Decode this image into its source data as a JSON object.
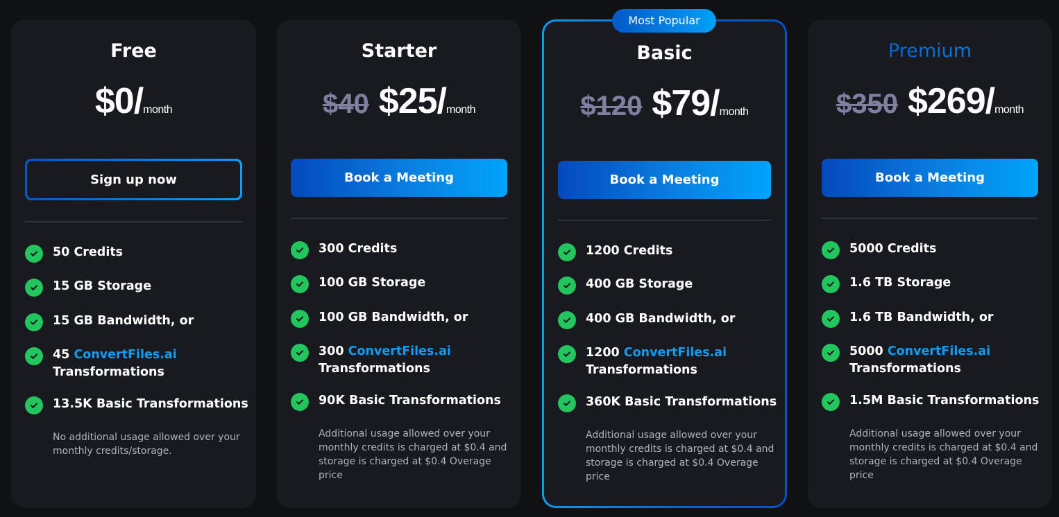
{
  "badge": "Most Popular",
  "colors": {
    "background": "#101113",
    "card": "#181a20",
    "accent_start": "#0449bd",
    "accent_end": "#00a4fb",
    "check": "#22c55e",
    "brand_link": "#129cf3",
    "old_price": "#7f80a0"
  },
  "plans": [
    {
      "name": "Free",
      "old_price": "",
      "price": "$0/",
      "period": "month",
      "button": "Sign up now",
      "features": {
        "credits": "50 Credits",
        "storage": "15 GB Storage",
        "bandwidth": "15 GB Bandwidth, or",
        "cf_count": "45",
        "cf_brand": "ConvertFiles.ai",
        "cf_suffix": "Transformations",
        "basic": "13.5K Basic Transformations"
      },
      "note": "No additional usage allowed over your monthly credits/storage."
    },
    {
      "name": "Starter",
      "old_price": "$40",
      "price": "$25/",
      "period": "month",
      "button": "Book a Meeting",
      "features": {
        "credits": "300 Credits",
        "storage": "100 GB Storage",
        "bandwidth": "100 GB Bandwidth, or",
        "cf_count": "300",
        "cf_brand": "ConvertFiles.ai",
        "cf_suffix": "Transformations",
        "basic": "90K Basic Transformations"
      },
      "note": "Additional usage allowed over your monthly credits is charged at $0.4 and storage is charged at $0.4 Overage price"
    },
    {
      "name": "Basic",
      "old_price": "$120",
      "price": "$79/",
      "period": "month",
      "button": "Book a Meeting",
      "features": {
        "credits": "1200 Credits",
        "storage": "400 GB Storage",
        "bandwidth": "400 GB Bandwidth, or",
        "cf_count": "1200",
        "cf_brand": "ConvertFiles.ai",
        "cf_suffix": "Transformations",
        "basic": "360K Basic Transformations"
      },
      "note": "Additional usage allowed over your monthly credits is charged at $0.4 and storage is charged at $0.4 Overage price"
    },
    {
      "name": "Premium",
      "old_price": "$350",
      "price": "$269/",
      "period": "month",
      "button": "Book a Meeting",
      "features": {
        "credits": "5000 Credits",
        "storage": "1.6 TB Storage",
        "bandwidth": "1.6 TB Bandwidth, or",
        "cf_count": "5000",
        "cf_brand": "ConvertFiles.ai",
        "cf_suffix": "Transformations",
        "basic": "1.5M Basic Transformations"
      },
      "note": "Additional usage allowed over your monthly credits is charged at $0.4 and storage is charged at $0.4 Overage price"
    }
  ]
}
